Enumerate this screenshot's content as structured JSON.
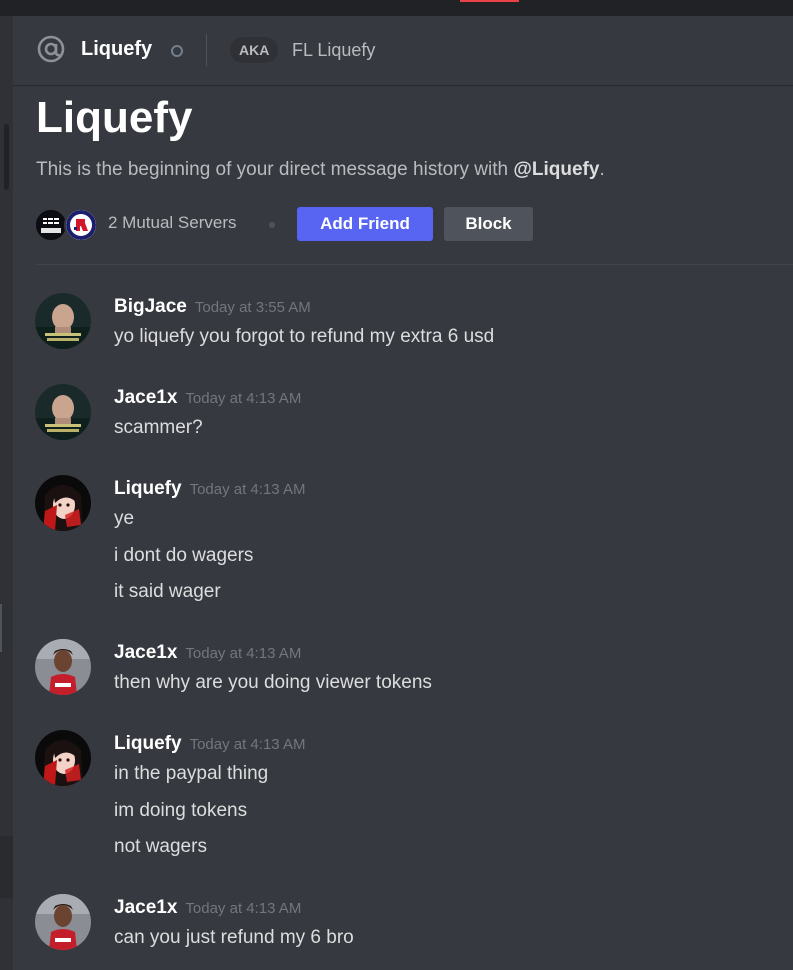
{
  "header": {
    "username": "Liquefy",
    "aka_label": "AKA",
    "nickname": "FL Liquefy"
  },
  "welcome": {
    "title": "Liquefy",
    "subtitle_prefix": "This is the beginning of your direct message history with ",
    "subtitle_handle": "@Liquefy",
    "subtitle_suffix": ".",
    "mutual_servers": "2 Mutual Servers",
    "add_friend_label": "Add Friend",
    "block_label": "Block"
  },
  "messages": [
    {
      "author": "BigJace",
      "timestamp": "Today at 3:55 AM",
      "lines": [
        "yo liquefy you forgot to refund my extra 6 usd"
      ]
    },
    {
      "author": "Jace1x",
      "timestamp": "Today at 4:13 AM",
      "lines": [
        "scammer?"
      ]
    },
    {
      "author": "Liquefy",
      "timestamp": "Today at 4:13 AM",
      "lines": [
        "ye",
        "i dont do wagers",
        "it said wager"
      ]
    },
    {
      "author": "Jace1x",
      "timestamp": "Today at 4:13 AM",
      "lines": [
        "then why are you doing viewer tokens"
      ]
    },
    {
      "author": "Liquefy",
      "timestamp": "Today at 4:13 AM",
      "lines": [
        "in the paypal thing",
        "im doing tokens",
        "not wagers"
      ]
    },
    {
      "author": "Jace1x",
      "timestamp": "Today at 4:13 AM",
      "lines": [
        "can you just refund my 6 bro"
      ]
    }
  ],
  "colors": {
    "background": "#36393f",
    "blurple": "#5865f2",
    "muted_text": "#b9bbbe",
    "timestamp": "#72767d"
  },
  "icons": {
    "header": "at-sign-icon",
    "status": "offline-status-icon"
  }
}
